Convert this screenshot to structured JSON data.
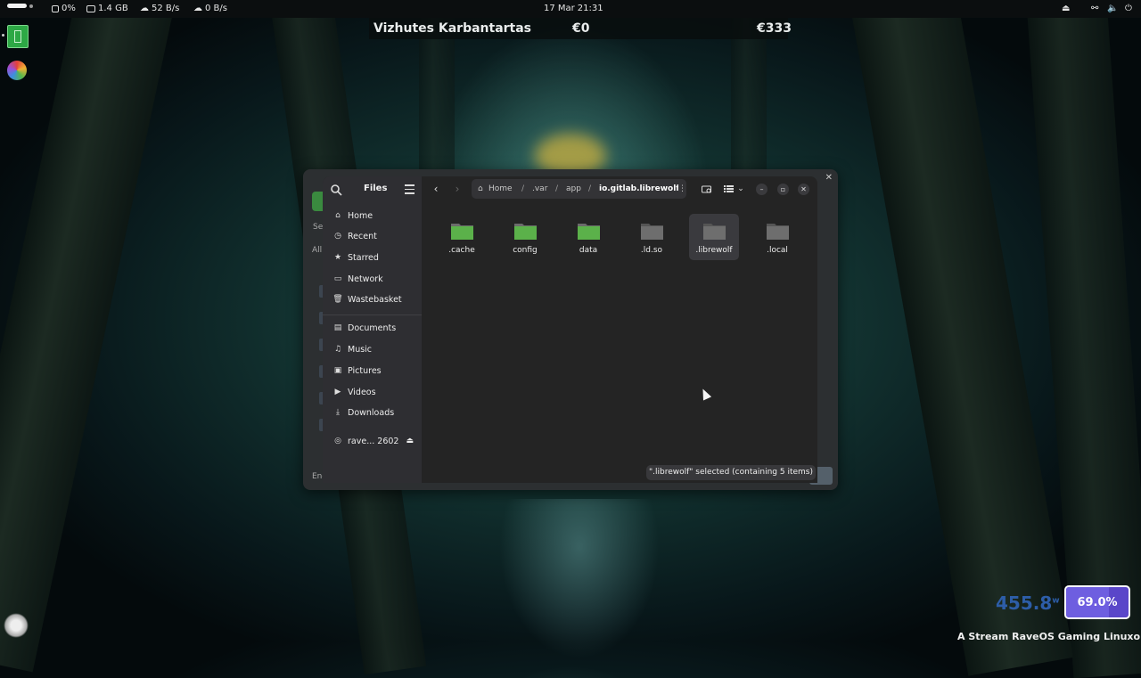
{
  "topbar": {
    "cpu": "0%",
    "memory": "1.4 GB",
    "net_down": "52 B/s",
    "net_up": "0 B/s",
    "date": "17 Mar",
    "time": "21:31"
  },
  "ticker": {
    "name": "Vizhutes Karbantartas",
    "value1": "€0",
    "value2": "€333"
  },
  "files": {
    "title": "Files",
    "sidebar_places": [
      {
        "label": "Home",
        "icon": "home-icon"
      },
      {
        "label": "Recent",
        "icon": "clock-icon"
      },
      {
        "label": "Starred",
        "icon": "star-icon"
      },
      {
        "label": "Network",
        "icon": "network-icon"
      },
      {
        "label": "Wastebasket",
        "icon": "trash-icon"
      }
    ],
    "sidebar_folders": [
      {
        "label": "Documents",
        "icon": "document-icon"
      },
      {
        "label": "Music",
        "icon": "music-icon"
      },
      {
        "label": "Pictures",
        "icon": "picture-icon"
      },
      {
        "label": "Videos",
        "icon": "video-icon"
      },
      {
        "label": "Downloads",
        "icon": "download-icon"
      }
    ],
    "device": {
      "label": "rave... 2602",
      "icon": "disc-icon"
    },
    "breadcrumb": {
      "home": "Home",
      "sep": "/",
      "var": ".var",
      "app": "app",
      "current": "io.gitlab.librewolf-"
    },
    "items": [
      ".cache",
      "config",
      "data",
      ".ld.so",
      ".librewolf",
      ".local"
    ],
    "status": "\".librewolf\" selected  (containing 5 items)"
  },
  "bgwindow": {
    "frag_se": "Se",
    "frag_all": "All",
    "frag_eng": "Eng"
  },
  "widgets": {
    "watts": "455.8",
    "watts_unit": "w",
    "battery": "69.0%",
    "battery_level": 0.69,
    "marquee": "A Stream RaveOS Gaming Linuxon fut"
  },
  "colors": {
    "folder_green": "#5bb14a",
    "folder_gray": "#6b6b6b",
    "battery": "#5a46c9",
    "watts": "#2d5da8"
  }
}
